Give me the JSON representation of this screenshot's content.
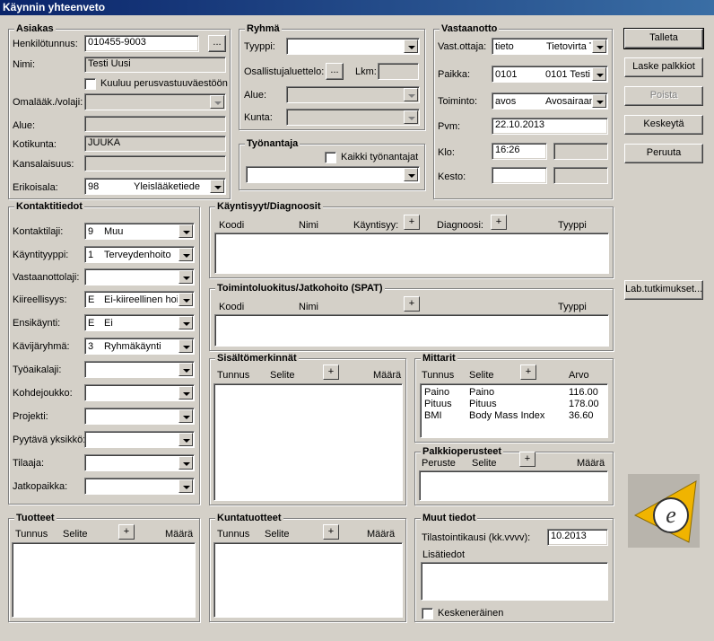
{
  "window": {
    "title": "Käynnin yhteenveto"
  },
  "asiakas": {
    "title": "Asiakas",
    "henkilotunnus_label": "Henkilötunnus:",
    "henkilotunnus": "010455-9003",
    "browse": "...",
    "nimi_label": "Nimi:",
    "nimi": "Testi Uusi",
    "perusvastuu_label": "Kuuluu perusvastuuväestöön",
    "omalaak_label": "Omalääk./volaji:",
    "alue_label": "Alue:",
    "kotikunta_label": "Kotikunta:",
    "kotikunta": "JUUKA",
    "kansalaisuus_label": "Kansalaisuus:",
    "erikoisala_label": "Erikoisala:",
    "erikoisala_code": "98",
    "erikoisala_name": "Yleislääketiede"
  },
  "ryhma": {
    "title": "Ryhmä",
    "tyyppi_label": "Tyyppi:",
    "osallistuja_label": "Osallistujaluettelo:",
    "browse": "...",
    "lkm_label": "Lkm:",
    "alue_label": "Alue:",
    "kunta_label": "Kunta:"
  },
  "tyonantaja": {
    "title": "Työnantaja",
    "kaikki_label": "Kaikki työnantajat"
  },
  "vastaanotto": {
    "title": "Vastaanotto",
    "vastottaja_label": "Vast.ottaja:",
    "vastottaja_code": "tieto",
    "vastottaja_name": "Tietovirta T",
    "paikka_label": "Paikka:",
    "paikka_code": "0101",
    "paikka_name": "0101 Testi",
    "toiminto_label": "Toiminto:",
    "toiminto_code": "avos",
    "toiminto_name": "Avosairaan",
    "pvm_label": "Pvm:",
    "pvm": "22.10.2013",
    "klo_label": "Klo:",
    "klo": "16:26",
    "kesto_label": "Kesto:"
  },
  "buttons": {
    "talleta": "Talleta",
    "laske": "Laske palkkiot",
    "poista": "Poista",
    "keskeyta": "Keskeytä",
    "peruuta": "Peruuta",
    "lab": "Lab.tutkimukset..."
  },
  "kontakti": {
    "title": "Kontaktitiedot",
    "rows": [
      {
        "label": "Kontaktilaji:",
        "code": "9",
        "name": "Muu"
      },
      {
        "label": "Käyntityyppi:",
        "code": "1",
        "name": "Terveydenhoito"
      },
      {
        "label": "Vastaanottolaji:",
        "code": "",
        "name": ""
      },
      {
        "label": "Kiireellisyys:",
        "code": "E",
        "name": "Ei-kiireellinen hoi"
      },
      {
        "label": "Ensikäynti:",
        "code": "E",
        "name": "Ei"
      },
      {
        "label": "Kävijäryhmä:",
        "code": "3",
        "name": "Ryhmäkäynti"
      },
      {
        "label": "Työaikalaji:",
        "code": "",
        "name": ""
      },
      {
        "label": "Kohdejoukko:",
        "code": "",
        "name": ""
      },
      {
        "label": "Projekti:",
        "code": "",
        "name": ""
      },
      {
        "label": "Pyytävä yksikkö:",
        "code": "",
        "name": ""
      },
      {
        "label": "Tilaaja:",
        "code": "",
        "name": ""
      },
      {
        "label": "Jatkopaikka:",
        "code": "",
        "name": ""
      }
    ]
  },
  "kayntisyyt": {
    "title": "Käyntisyyt/Diagnoosit",
    "koodi": "Koodi",
    "nimi": "Nimi",
    "kayntisyy": "Käyntisyy:",
    "diagnoosi": "Diagnoosi:",
    "tyyppi": "Tyyppi",
    "plus": "+"
  },
  "toimintoluokitus": {
    "title": "Toimintoluokitus/Jatkohoito (SPAT)",
    "koodi": "Koodi",
    "nimi": "Nimi",
    "tyyppi": "Tyyppi",
    "plus": "+"
  },
  "sisalto": {
    "title": "Sisältömerkinnät",
    "tunnus": "Tunnus",
    "selite": "Selite",
    "maara": "Määrä",
    "plus": "+"
  },
  "mittarit": {
    "title": "Mittarit",
    "tunnus": "Tunnus",
    "selite": "Selite",
    "arvo": "Arvo",
    "plus": "+",
    "rows": [
      {
        "tunnus": "Paino",
        "selite": "Paino",
        "arvo": "116.00"
      },
      {
        "tunnus": "Pituus",
        "selite": "Pituus",
        "arvo": "178.00"
      },
      {
        "tunnus": "BMI",
        "selite": "Body Mass Index",
        "arvo": "36.60"
      }
    ]
  },
  "palkkio": {
    "title": "Palkkioperusteet",
    "peruste": "Peruste",
    "selite": "Selite",
    "maara": "Määrä",
    "plus": "+"
  },
  "tuotteet": {
    "title": "Tuotteet",
    "tunnus": "Tunnus",
    "selite": "Selite",
    "maara": "Määrä",
    "plus": "+"
  },
  "kuntatuotteet": {
    "title": "Kuntatuotteet",
    "tunnus": "Tunnus",
    "selite": "Selite",
    "maara": "Määrä",
    "plus": "+"
  },
  "muut": {
    "title": "Muut tiedot",
    "tilastointi_label": "Tilastointikausi (kk.vvvv):",
    "tilastointi": "10.2013",
    "lisatiedot_label": "Lisätiedot",
    "keskenerainen_label": "Keskeneräinen"
  },
  "logo": {
    "letter": "e",
    "colors": {
      "primary": "#f0b400",
      "background": "#b8b4ac"
    }
  }
}
